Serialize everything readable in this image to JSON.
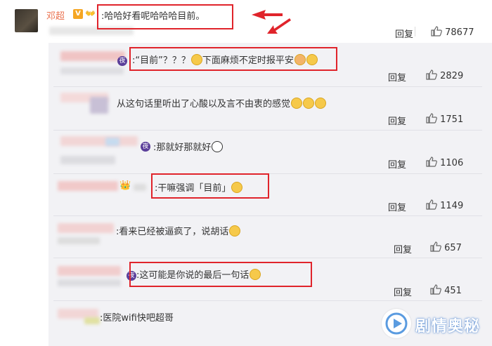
{
  "main_comment": {
    "author": "邓超",
    "text": ":哈哈好看呢哈哈哈目前。",
    "reply_label": "回复",
    "likes": "78677"
  },
  "replies": [
    {
      "text": ":“目前”？？？",
      "text2": "下面麻烦不定时报平安",
      "reply_label": "回复",
      "likes": "2829"
    },
    {
      "text": "从这句话里听出了心酸以及言不由衷的感觉",
      "reply_label": "回复",
      "likes": "1751"
    },
    {
      "text": ":那就好那就好",
      "reply_label": "回复",
      "likes": "1106"
    },
    {
      "text": ":干嘛强调「目前」",
      "reply_label": "回复",
      "likes": "1149"
    },
    {
      "text": ":看来已经被逼疯了，说胡话",
      "reply_label": "回复",
      "likes": "657"
    },
    {
      "text": ":这可能是你说的最后一句话",
      "reply_label": "回复",
      "likes": "451"
    },
    {
      "text": ":医院wifi快吧超哥"
    }
  ],
  "watermark": {
    "text": "剧情奥秘"
  },
  "colors": {
    "highlight_box": "#e0242b",
    "author_name": "#eb7350",
    "panel_bg": "#f2f2f5"
  }
}
